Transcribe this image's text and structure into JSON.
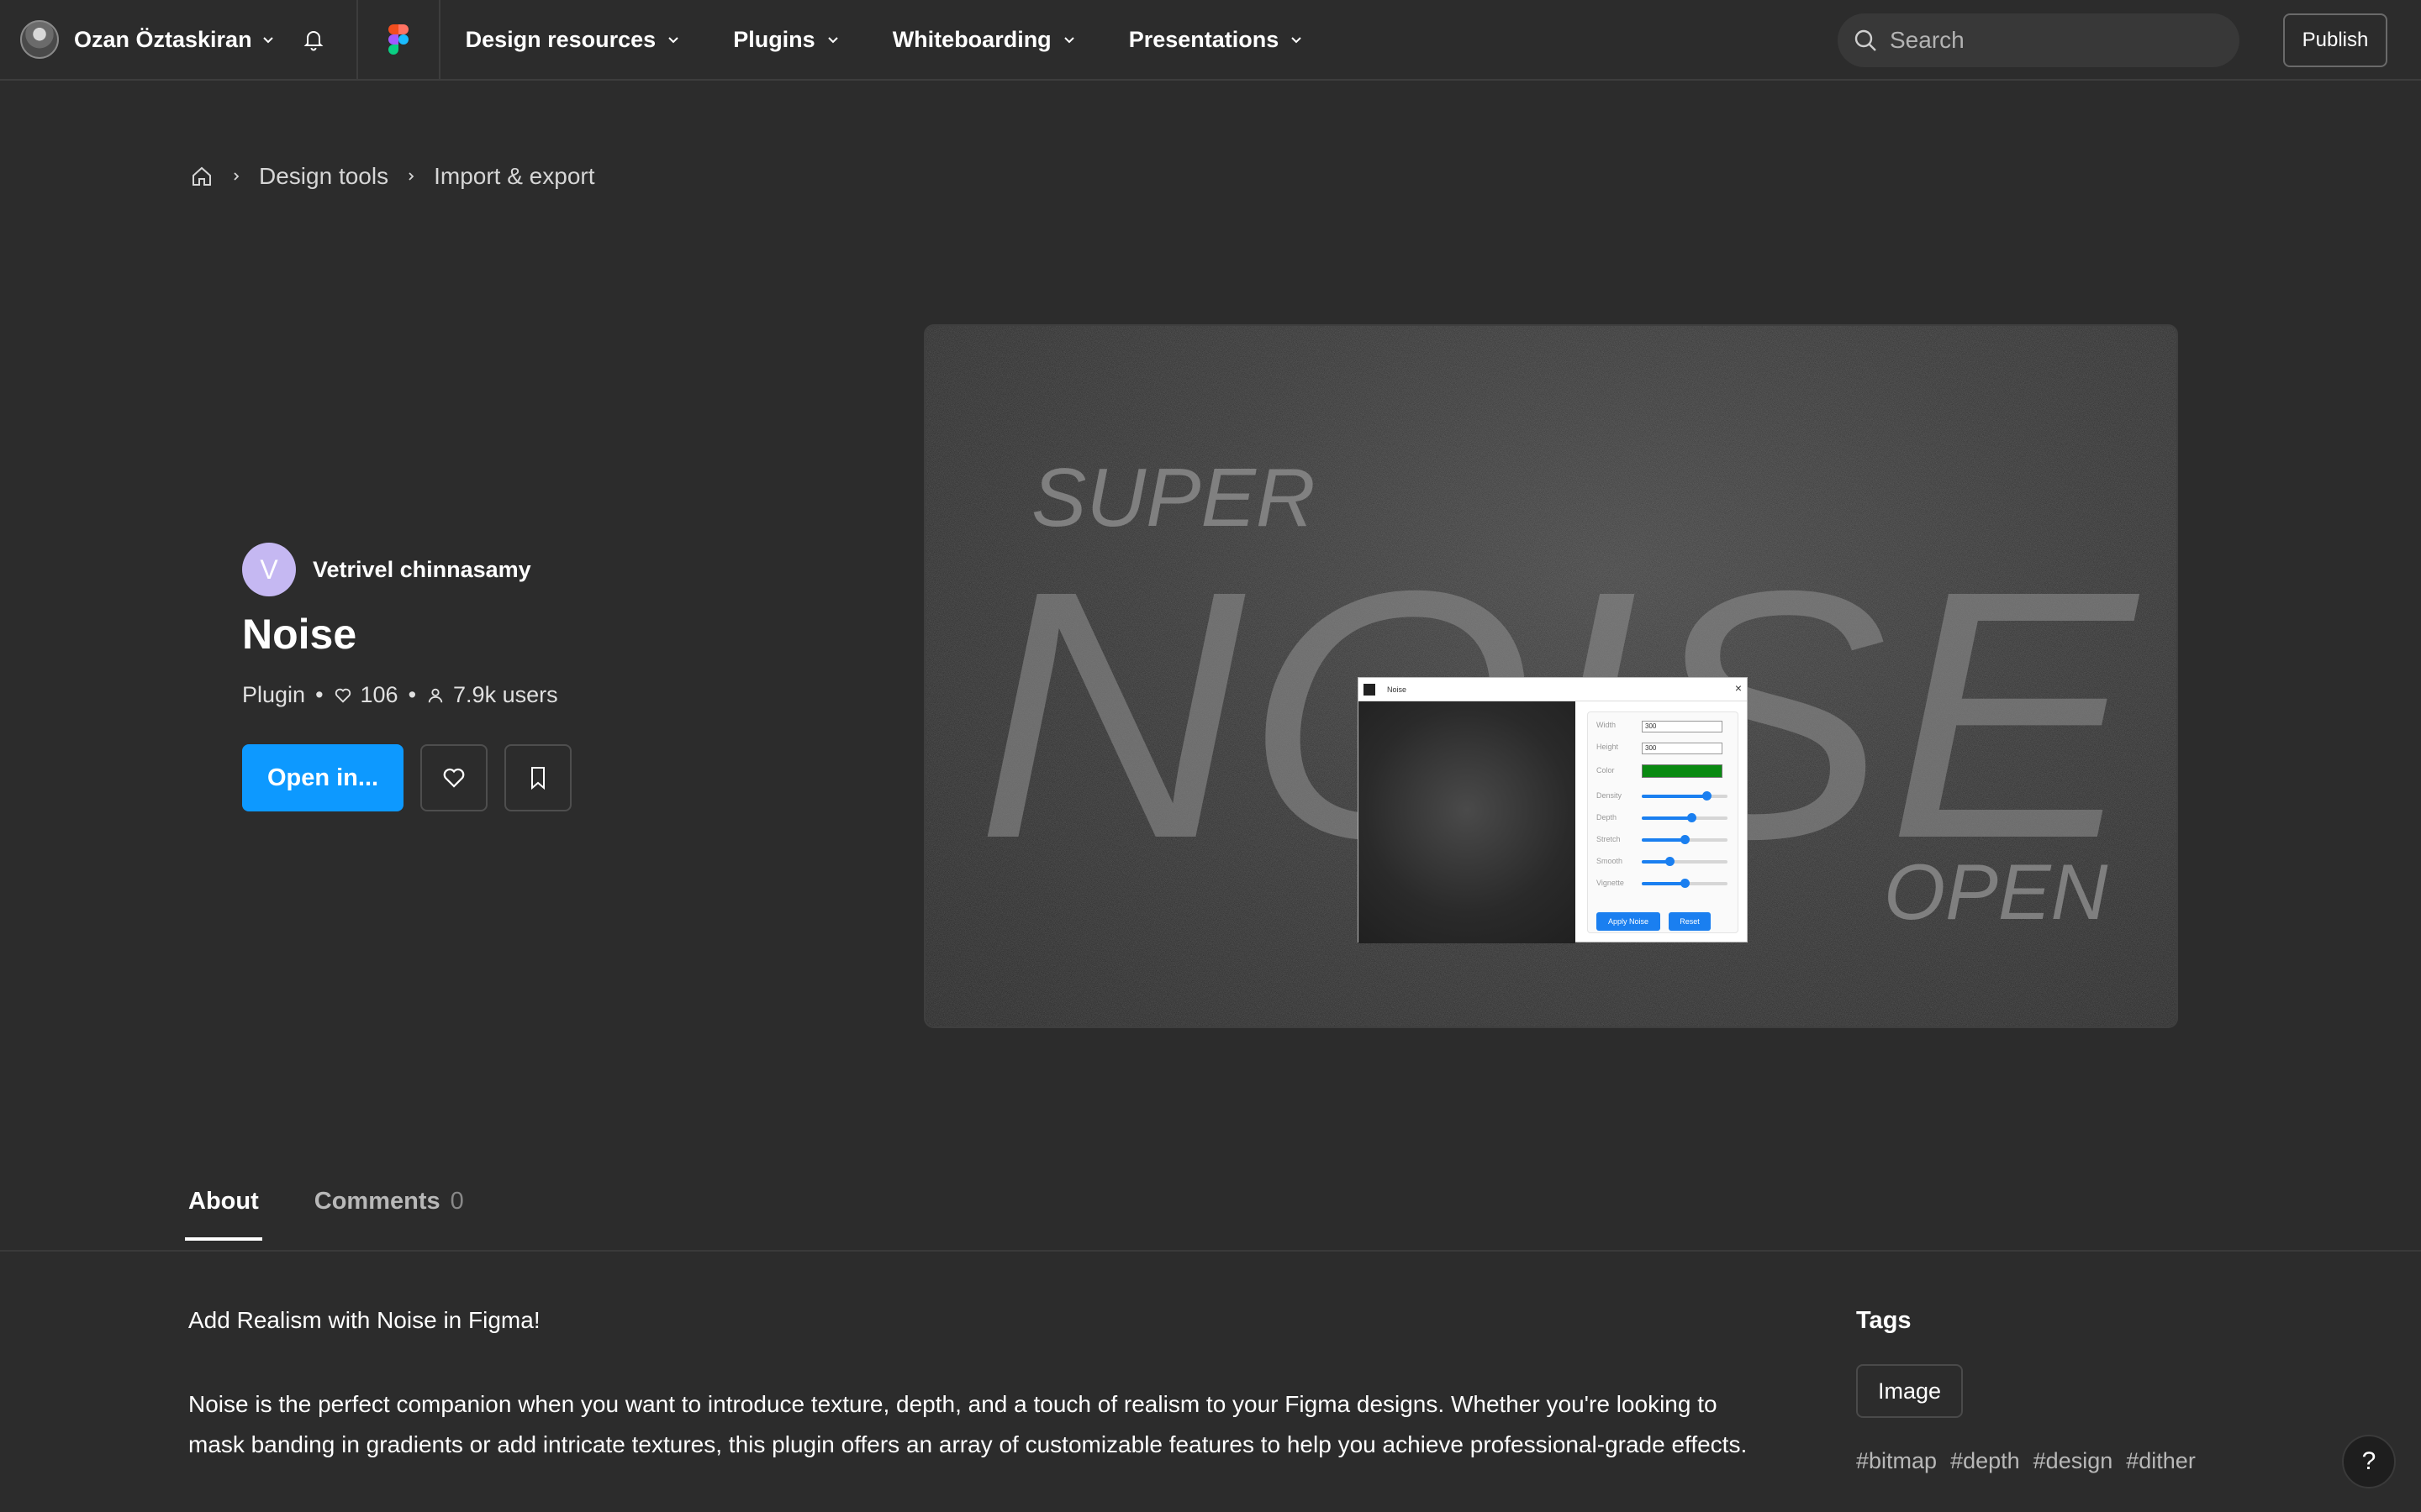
{
  "topbar": {
    "user_name": "Ozan Öztaskiran",
    "nav": [
      {
        "label": "Design resources"
      },
      {
        "label": "Plugins"
      },
      {
        "label": "Whiteboarding"
      },
      {
        "label": "Presentations"
      }
    ],
    "search_placeholder": "Search",
    "publish_label": "Publish"
  },
  "breadcrumb": {
    "items": [
      "Design tools",
      "Import & export"
    ]
  },
  "plugin": {
    "author_initial": "V",
    "author_name": "Vetrivel chinnasamy",
    "title": "Noise",
    "type": "Plugin",
    "likes": "106",
    "users": "7.9k users",
    "open_label": "Open in..."
  },
  "hero": {
    "word_super": "SUPER",
    "word_noise": "NOISE",
    "word_open": "OPEN",
    "mini_title": "Noise",
    "fields": {
      "width_label": "Width",
      "width_value": "300",
      "height_label": "Height",
      "height_value": "300",
      "color_label": "Color",
      "density_label": "Density",
      "density_level": 0.75,
      "depth_label": "Depth",
      "depth_level": 0.58,
      "stretch_label": "Stretch",
      "stretch_level": 0.5,
      "smooth_label": "Smooth",
      "smooth_level": 0.32,
      "vignette_label": "Vignette",
      "vignette_level": 0.5
    },
    "apply_label": "Apply Noise",
    "reset_label": "Reset"
  },
  "tabs": {
    "about": "About",
    "comments": "Comments",
    "comments_count": "0"
  },
  "about": {
    "headline": "Add Realism with Noise in Figma!",
    "body": "Noise is the perfect companion when you want to introduce texture, depth, and a touch of realism to your Figma designs. Whether you're looking to mask banding in gradients or add intricate textures, this plugin offers an array of customizable features to help you achieve professional-grade effects."
  },
  "tags": {
    "title": "Tags",
    "chip": "Image",
    "hashtags": [
      "#bitmap",
      "#depth",
      "#design",
      "#dither"
    ]
  },
  "help_label": "?",
  "colors": {
    "accent": "#0d99ff",
    "background": "#2c2c2c",
    "author_avatar": "#c5b8f2"
  }
}
